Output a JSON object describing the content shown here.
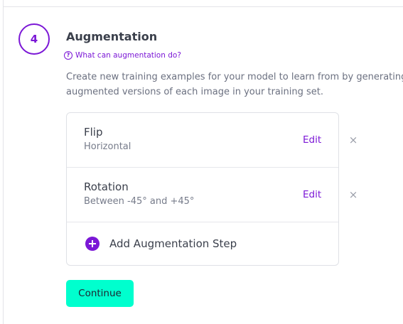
{
  "step": {
    "number": "4",
    "title": "Augmentation",
    "help_link": "What can augmentation do?",
    "help_icon_glyph": "?",
    "description_line1": "Create new training examples for your model to learn from by generating",
    "description_line2": "augmented versions of each image in your training set."
  },
  "augmentations": [
    {
      "title": "Flip",
      "detail": "Horizontal",
      "edit_label": "Edit",
      "remove_glyph": "×"
    },
    {
      "title": "Rotation",
      "detail": "Between -45° and +45°",
      "edit_label": "Edit",
      "remove_glyph": "×"
    }
  ],
  "add_step_label": "Add Augmentation Step",
  "continue_label": "Continue",
  "icons": {
    "help": "question-circle-icon",
    "remove": "close-icon",
    "add": "plus-circle-icon"
  },
  "colors": {
    "accent": "#7b17d6",
    "continue_bg": "#00ffce",
    "text_primary": "#3a3f4b",
    "text_secondary": "#6b7080",
    "border": "#dfe1e6"
  }
}
